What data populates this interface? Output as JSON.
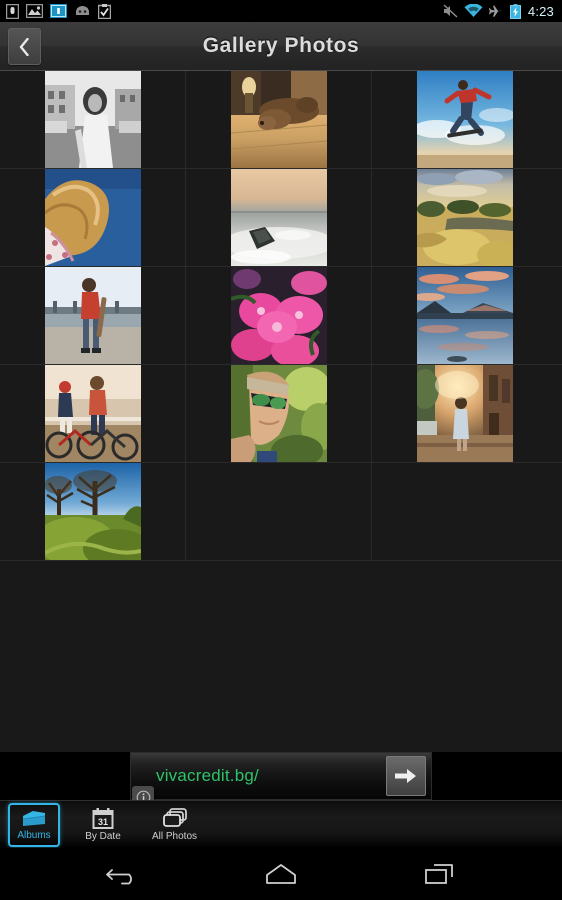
{
  "status_bar": {
    "left_icons": [
      {
        "name": "sd-card-icon"
      },
      {
        "name": "image-download-icon"
      },
      {
        "name": "usb-debug-icon"
      },
      {
        "name": "android-robot-icon"
      },
      {
        "name": "clipboard-check-icon"
      }
    ],
    "right_icons": [
      {
        "name": "mute-icon"
      },
      {
        "name": "wifi-icon"
      },
      {
        "name": "airplane-mode-icon"
      },
      {
        "name": "battery-charging-icon"
      }
    ],
    "time": "4:23"
  },
  "title_bar": {
    "back_label": "‹",
    "title": "Gallery Photos"
  },
  "grid": {
    "rows": [
      [
        {
          "name": "photo-street-bw",
          "alt": "Black and white street portrait"
        },
        {
          "name": "photo-dog-floor",
          "alt": "Dog lying on wooden floor"
        },
        {
          "name": "photo-skateboard-jump",
          "alt": "Skateboarder jumping in sky"
        }
      ],
      [
        {
          "name": "photo-hair-blue-sky",
          "alt": "Girl with flowing hair against blue sky"
        },
        {
          "name": "photo-ocean-rock",
          "alt": "Long exposure ocean waves and rock"
        },
        {
          "name": "photo-marsh-sunset",
          "alt": "Golden marsh landscape at sunset"
        }
      ],
      [
        {
          "name": "photo-skater-boy",
          "alt": "Boy with skateboard by the pier"
        },
        {
          "name": "photo-pink-flowers",
          "alt": "Pink dianthus flowers close-up"
        },
        {
          "name": "photo-lake-reflection",
          "alt": "Mountain lake reflection at dusk"
        }
      ],
      [
        {
          "name": "photo-friends-bikes",
          "alt": "Two friends sitting with bicycles"
        },
        {
          "name": "photo-woman-sunglasses",
          "alt": "Woman wearing mirrored sunglasses"
        },
        {
          "name": "photo-street-walk-sunset",
          "alt": "Person walking down sunlit street"
        }
      ],
      [
        {
          "name": "photo-trees-meadow",
          "alt": "Trees and green meadow under blue sky"
        }
      ]
    ]
  },
  "ad": {
    "url_text": "vivacredit.bg/",
    "go_label": "→",
    "info_label": "i"
  },
  "tab_bar": {
    "tabs": [
      {
        "name": "tab-albums",
        "label": "Albums",
        "icon": "albums-icon",
        "active": true
      },
      {
        "name": "tab-by-date",
        "label": "By Date",
        "icon": "calendar-icon",
        "active": false
      },
      {
        "name": "tab-all-photos",
        "label": "All Photos",
        "icon": "stack-icon",
        "active": false
      }
    ]
  },
  "nav_bar": {
    "buttons": [
      {
        "name": "nav-back-button",
        "icon": "back-arrow-icon"
      },
      {
        "name": "nav-home-button",
        "icon": "home-icon"
      },
      {
        "name": "nav-recents-button",
        "icon": "recent-apps-icon"
      }
    ]
  },
  "colors": {
    "accent": "#33b5e5",
    "ad_green": "#2fc269",
    "grid_bg": "#191919"
  }
}
